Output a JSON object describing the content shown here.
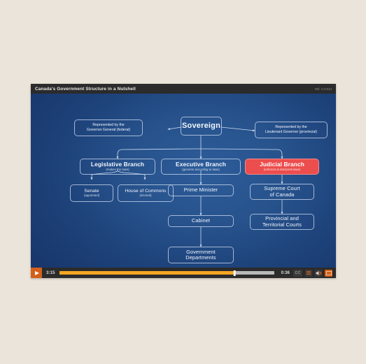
{
  "player": {
    "title": "Canada's Government Structure in a Nutshell",
    "reference": "Ref. V.17414",
    "play_label": "play-icon",
    "time_elapsed": "3:15",
    "time_remaining": "0:36",
    "progress_percent": 81.5,
    "cc_label": "CC",
    "menu_label": "menu-icon",
    "volume_label": "volume-muted-icon",
    "fullscreen_label": "fullscreen-icon",
    "accent_color": "#d2601a",
    "progress_color": "#f5a623",
    "bar_color": "#2b2b2b"
  },
  "slide": {
    "background_from": "#2d5c99",
    "background_to": "#163468",
    "accent_color": "#ec4d4d",
    "nodes": {
      "gov_general": {
        "title": "Represented by the",
        "title2": "Governor General (federal)"
      },
      "sovereign": {
        "title": "Sovereign"
      },
      "lt_governor": {
        "title": "Represented by the",
        "title2": "Lieutenant Governor (provincial)"
      },
      "legislative": {
        "title": "Legislative Branch",
        "sub": "(makes the laws)"
      },
      "executive": {
        "title": "Executive Branch",
        "sub": "(governs according to laws)"
      },
      "judicial": {
        "title": "Judicial Branch",
        "sub": "(enforces & interprets laws)"
      },
      "senate": {
        "title": "Senate",
        "sub": "(appointed)"
      },
      "commons": {
        "title": "House of Commons",
        "sub": "(elected)"
      },
      "prime_minister": {
        "title": "Prime Minister"
      },
      "supreme_court": {
        "title": "Supreme Court",
        "title2": "of Canada"
      },
      "cabinet": {
        "title": "Cabinet"
      },
      "provincial_courts": {
        "title": "Provincial and",
        "title2": "Territorial Courts"
      },
      "departments": {
        "title": "Government",
        "title2": "Departments"
      }
    }
  }
}
